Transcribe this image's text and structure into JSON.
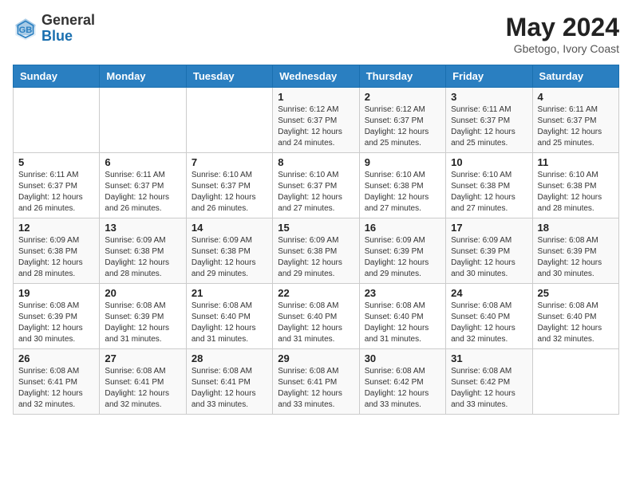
{
  "header": {
    "logo_general": "General",
    "logo_blue": "Blue",
    "month_title": "May 2024",
    "subtitle": "Gbetogo, Ivory Coast"
  },
  "days_of_week": [
    "Sunday",
    "Monday",
    "Tuesday",
    "Wednesday",
    "Thursday",
    "Friday",
    "Saturday"
  ],
  "weeks": [
    [
      {
        "day": "",
        "info": ""
      },
      {
        "day": "",
        "info": ""
      },
      {
        "day": "",
        "info": ""
      },
      {
        "day": "1",
        "info": "Sunrise: 6:12 AM\nSunset: 6:37 PM\nDaylight: 12 hours and 24 minutes."
      },
      {
        "day": "2",
        "info": "Sunrise: 6:12 AM\nSunset: 6:37 PM\nDaylight: 12 hours and 25 minutes."
      },
      {
        "day": "3",
        "info": "Sunrise: 6:11 AM\nSunset: 6:37 PM\nDaylight: 12 hours and 25 minutes."
      },
      {
        "day": "4",
        "info": "Sunrise: 6:11 AM\nSunset: 6:37 PM\nDaylight: 12 hours and 25 minutes."
      }
    ],
    [
      {
        "day": "5",
        "info": "Sunrise: 6:11 AM\nSunset: 6:37 PM\nDaylight: 12 hours and 26 minutes."
      },
      {
        "day": "6",
        "info": "Sunrise: 6:11 AM\nSunset: 6:37 PM\nDaylight: 12 hours and 26 minutes."
      },
      {
        "day": "7",
        "info": "Sunrise: 6:10 AM\nSunset: 6:37 PM\nDaylight: 12 hours and 26 minutes."
      },
      {
        "day": "8",
        "info": "Sunrise: 6:10 AM\nSunset: 6:37 PM\nDaylight: 12 hours and 27 minutes."
      },
      {
        "day": "9",
        "info": "Sunrise: 6:10 AM\nSunset: 6:38 PM\nDaylight: 12 hours and 27 minutes."
      },
      {
        "day": "10",
        "info": "Sunrise: 6:10 AM\nSunset: 6:38 PM\nDaylight: 12 hours and 27 minutes."
      },
      {
        "day": "11",
        "info": "Sunrise: 6:10 AM\nSunset: 6:38 PM\nDaylight: 12 hours and 28 minutes."
      }
    ],
    [
      {
        "day": "12",
        "info": "Sunrise: 6:09 AM\nSunset: 6:38 PM\nDaylight: 12 hours and 28 minutes."
      },
      {
        "day": "13",
        "info": "Sunrise: 6:09 AM\nSunset: 6:38 PM\nDaylight: 12 hours and 28 minutes."
      },
      {
        "day": "14",
        "info": "Sunrise: 6:09 AM\nSunset: 6:38 PM\nDaylight: 12 hours and 29 minutes."
      },
      {
        "day": "15",
        "info": "Sunrise: 6:09 AM\nSunset: 6:38 PM\nDaylight: 12 hours and 29 minutes."
      },
      {
        "day": "16",
        "info": "Sunrise: 6:09 AM\nSunset: 6:39 PM\nDaylight: 12 hours and 29 minutes."
      },
      {
        "day": "17",
        "info": "Sunrise: 6:09 AM\nSunset: 6:39 PM\nDaylight: 12 hours and 30 minutes."
      },
      {
        "day": "18",
        "info": "Sunrise: 6:08 AM\nSunset: 6:39 PM\nDaylight: 12 hours and 30 minutes."
      }
    ],
    [
      {
        "day": "19",
        "info": "Sunrise: 6:08 AM\nSunset: 6:39 PM\nDaylight: 12 hours and 30 minutes."
      },
      {
        "day": "20",
        "info": "Sunrise: 6:08 AM\nSunset: 6:39 PM\nDaylight: 12 hours and 31 minutes."
      },
      {
        "day": "21",
        "info": "Sunrise: 6:08 AM\nSunset: 6:40 PM\nDaylight: 12 hours and 31 minutes."
      },
      {
        "day": "22",
        "info": "Sunrise: 6:08 AM\nSunset: 6:40 PM\nDaylight: 12 hours and 31 minutes."
      },
      {
        "day": "23",
        "info": "Sunrise: 6:08 AM\nSunset: 6:40 PM\nDaylight: 12 hours and 31 minutes."
      },
      {
        "day": "24",
        "info": "Sunrise: 6:08 AM\nSunset: 6:40 PM\nDaylight: 12 hours and 32 minutes."
      },
      {
        "day": "25",
        "info": "Sunrise: 6:08 AM\nSunset: 6:40 PM\nDaylight: 12 hours and 32 minutes."
      }
    ],
    [
      {
        "day": "26",
        "info": "Sunrise: 6:08 AM\nSunset: 6:41 PM\nDaylight: 12 hours and 32 minutes."
      },
      {
        "day": "27",
        "info": "Sunrise: 6:08 AM\nSunset: 6:41 PM\nDaylight: 12 hours and 32 minutes."
      },
      {
        "day": "28",
        "info": "Sunrise: 6:08 AM\nSunset: 6:41 PM\nDaylight: 12 hours and 33 minutes."
      },
      {
        "day": "29",
        "info": "Sunrise: 6:08 AM\nSunset: 6:41 PM\nDaylight: 12 hours and 33 minutes."
      },
      {
        "day": "30",
        "info": "Sunrise: 6:08 AM\nSunset: 6:42 PM\nDaylight: 12 hours and 33 minutes."
      },
      {
        "day": "31",
        "info": "Sunrise: 6:08 AM\nSunset: 6:42 PM\nDaylight: 12 hours and 33 minutes."
      },
      {
        "day": "",
        "info": ""
      }
    ]
  ]
}
